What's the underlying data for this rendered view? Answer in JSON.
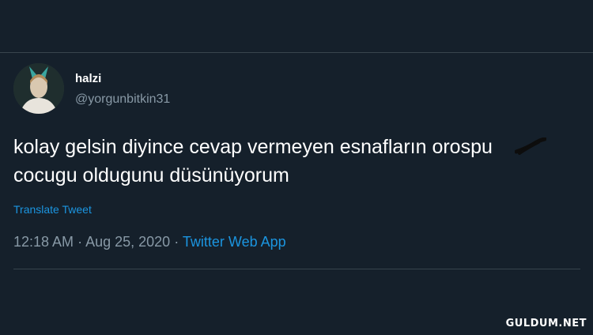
{
  "tweet": {
    "display_name": "halzi",
    "handle": "@yorgunbitkin31",
    "text_line_1": "kolay gelsin diyince cevap vermeyen esnafların orospu",
    "text_line_2": "cocugu oldugunu düsünüyorum",
    "translate_label": "Translate Tweet",
    "time": "12:18 AM",
    "separator": "·",
    "date": "Aug 25, 2020",
    "source": "Twitter Web App"
  },
  "watermark": "GULDUM.NET",
  "colors": {
    "background": "#15202b",
    "text": "#ffffff",
    "muted": "#8899a6",
    "link": "#1b95e0",
    "divider": "#38444d"
  }
}
